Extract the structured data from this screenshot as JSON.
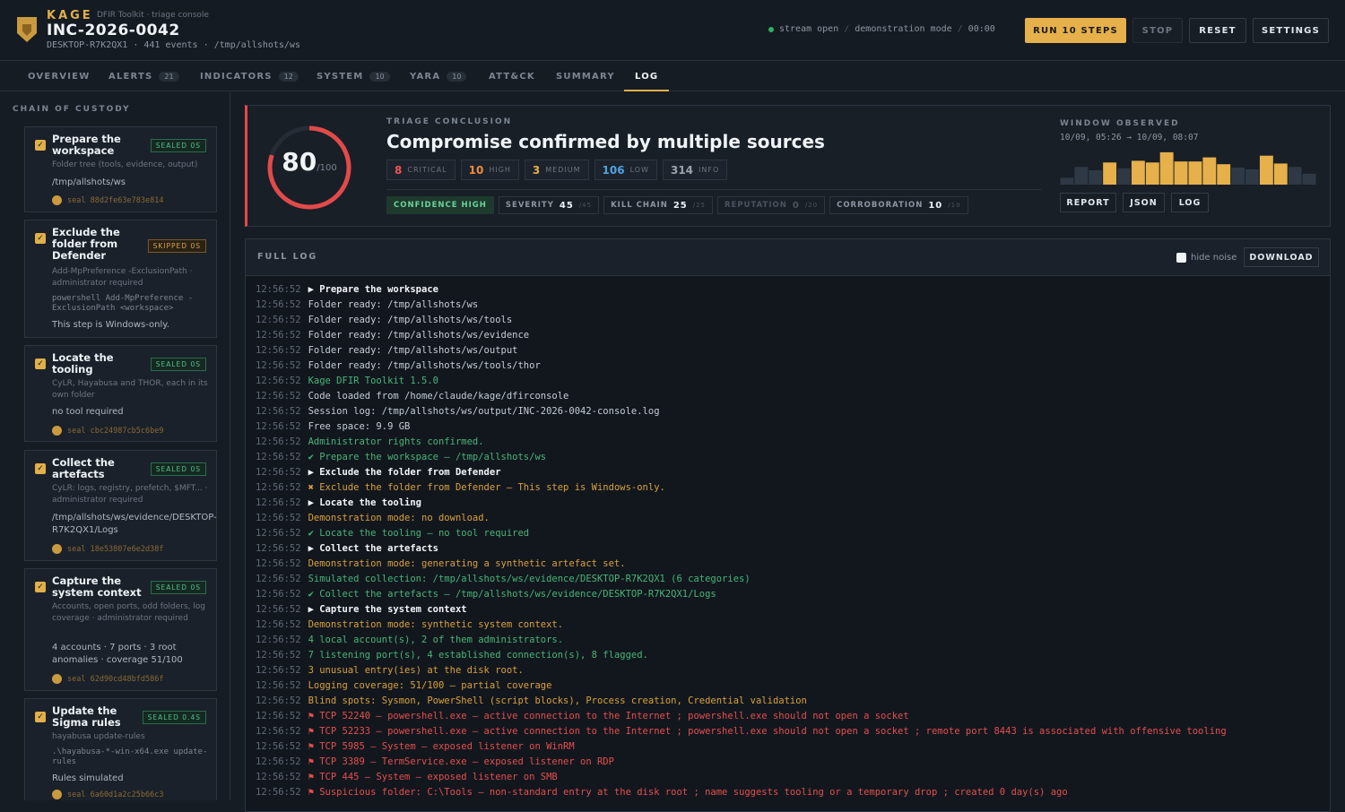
{
  "header": {
    "brand": "KAGE",
    "brand_sub": "DFIR Toolkit · triage console",
    "case_id": "INC-2026-0042",
    "meta": "DESKTOP-R7K2QX1 · 441 events · /tmp/allshots/ws",
    "status": {
      "stream": "stream open",
      "mode": "demonstration mode",
      "time": "00:00"
    },
    "buttons": {
      "run": "RUN 10 STEPS",
      "stop": "STOP",
      "reset": "RESET",
      "settings": "SETTINGS"
    }
  },
  "tabs": [
    {
      "label": "OVERVIEW",
      "count": ""
    },
    {
      "label": "ALERTS",
      "count": "21"
    },
    {
      "label": "INDICATORS",
      "count": "12"
    },
    {
      "label": "SYSTEM",
      "count": "10"
    },
    {
      "label": "YARA",
      "count": "10"
    },
    {
      "label": "ATT&CK",
      "count": ""
    },
    {
      "label": "SUMMARY",
      "count": ""
    },
    {
      "label": "LOG",
      "count": ""
    }
  ],
  "sidebar": {
    "title": "CHAIN OF CUSTODY",
    "steps": [
      {
        "title": "Prepare the workspace",
        "badge": "SEALED 0S",
        "desc": "Folder tree (tools, evidence, output)",
        "value": "/tmp/allshots/ws",
        "seal": "seal 88d2fe63e783e814"
      },
      {
        "title": "Exclude the folder from Defender",
        "badge": "SKIPPED 0S",
        "desc": "Add-MpPreference -ExclusionPath · administrator required",
        "cmd": "powershell Add-MpPreference -ExclusionPath <workspace>",
        "value": "This step is Windows-only."
      },
      {
        "title": "Locate the tooling",
        "badge": "SEALED 0S",
        "desc": "CyLR, Hayabusa and THOR, each in its own folder",
        "value": "no tool required",
        "seal": "seal cbc24987cb5c6be9"
      },
      {
        "title": "Collect the artefacts",
        "badge": "SEALED 0S",
        "desc": "CyLR: logs, registry, prefetch, $MFT... · administrator required",
        "value": "/tmp/allshots/ws/evidence/DESKTOP-R7K2QX1/Logs",
        "seal": "seal 18e53807e6e2d38f"
      },
      {
        "title": "Capture the system context",
        "badge": "SEALED 0S",
        "desc": "Accounts, open ports, odd folders, log coverage · administrator required",
        "value": "4 accounts · 7 ports · 3 root anomalies · coverage 51/100",
        "seal": "seal 62d90cd48bfd586f"
      },
      {
        "title": "Update the Sigma rules",
        "badge": "SEALED 0.4S",
        "desc": "hayabusa update-rules",
        "cmd": ".\\hayabusa-*-win-x64.exe update-rules",
        "value": "Rules simulated",
        "seal": "seal 6a60d1a2c25b66c3"
      }
    ]
  },
  "conclusion": {
    "label": "TRIAGE CONCLUSION",
    "title": "Compromise confirmed by multiple sources",
    "score": 80,
    "score_max": "/100",
    "severities": [
      {
        "n": "8",
        "l": "CRITICAL",
        "c": "#ef5350"
      },
      {
        "n": "10",
        "l": "HIGH",
        "c": "#f08a3c"
      },
      {
        "n": "3",
        "l": "MEDIUM",
        "c": "#e6b04a"
      },
      {
        "n": "106",
        "l": "LOW",
        "c": "#4ea3e0"
      },
      {
        "n": "314",
        "l": "INFO",
        "c": "#9aa3ad"
      }
    ],
    "pills": [
      {
        "l": "CONFIDENCE HIGH",
        "v": "",
        "m": "",
        "k": "conf"
      },
      {
        "l": "SEVERITY",
        "v": "45",
        "m": "/45",
        "k": ""
      },
      {
        "l": "KILL CHAIN",
        "v": "25",
        "m": "/25",
        "k": ""
      },
      {
        "l": "REPUTATION",
        "v": "0",
        "m": "/20",
        "k": "dim"
      },
      {
        "l": "CORROBORATION",
        "v": "10",
        "m": "/10",
        "k": ""
      }
    ],
    "window": {
      "label": "WINDOW OBSERVED",
      "range": "10/09, 05:26 → 10/09, 08:07",
      "hist": [
        0.2,
        0.52,
        0.42,
        0.65,
        0.48,
        0.7,
        0.65,
        0.95,
        0.68,
        0.68,
        0.8,
        0.6,
        0.5,
        0.45,
        0.85,
        0.62,
        0.52,
        0.32
      ]
    },
    "buttons": {
      "report": "REPORT",
      "json": "JSON",
      "log": "LOG"
    }
  },
  "log": {
    "title": "FULL LOG",
    "hide_noise": "hide noise",
    "download": "DOWNLOAD",
    "lines": [
      [
        "12:56:52",
        "▶ Prepare the workspace",
        "head"
      ],
      [
        "12:56:52",
        "Folder ready: /tmp/allshots/ws",
        "plain"
      ],
      [
        "12:56:52",
        "Folder ready: /tmp/allshots/ws/tools",
        "plain"
      ],
      [
        "12:56:52",
        "Folder ready: /tmp/allshots/ws/evidence",
        "plain"
      ],
      [
        "12:56:52",
        "Folder ready: /tmp/allshots/ws/output",
        "plain"
      ],
      [
        "12:56:52",
        "Folder ready: /tmp/allshots/ws/tools/thor",
        "plain"
      ],
      [
        "12:56:52",
        "Kage DFIR Toolkit 1.5.0",
        "green"
      ],
      [
        "12:56:52",
        "Code loaded from /home/claude/kage/dfirconsole",
        "plain"
      ],
      [
        "12:56:52",
        "Session log: /tmp/allshots/ws/output/INC-2026-0042-console.log",
        "plain"
      ],
      [
        "12:56:52",
        "Free space: 9.9 GB",
        "plain"
      ],
      [
        "12:56:52",
        "Administrator rights confirmed.",
        "green"
      ],
      [
        "12:56:52",
        "✔ Prepare the workspace — /tmp/allshots/ws",
        "green"
      ],
      [
        "12:56:52",
        "▶ Exclude the folder from Defender",
        "head"
      ],
      [
        "12:56:52",
        "✖ Exclude the folder from Defender — This step is Windows-only.",
        "amber"
      ],
      [
        "12:56:52",
        "▶ Locate the tooling",
        "head"
      ],
      [
        "12:56:52",
        "Demonstration mode: no download.",
        "amber"
      ],
      [
        "12:56:52",
        "✔ Locate the tooling — no tool required",
        "green"
      ],
      [
        "12:56:52",
        "▶ Collect the artefacts",
        "head"
      ],
      [
        "12:56:52",
        "Demonstration mode: generating a synthetic artefact set.",
        "amber"
      ],
      [
        "12:56:52",
        "Simulated collection: /tmp/allshots/ws/evidence/DESKTOP-R7K2QX1 (6 categories)",
        "green"
      ],
      [
        "12:56:52",
        "✔ Collect the artefacts — /tmp/allshots/ws/evidence/DESKTOP-R7K2QX1/Logs",
        "green"
      ],
      [
        "12:56:52",
        "▶ Capture the system context",
        "head"
      ],
      [
        "12:56:52",
        "Demonstration mode: synthetic system context.",
        "amber"
      ],
      [
        "12:56:52",
        "4 local account(s), 2 of them administrators.",
        "green"
      ],
      [
        "12:56:52",
        "7 listening port(s), 4 established connection(s), 8 flagged.",
        "green"
      ],
      [
        "12:56:52",
        "3 unusual entry(ies) at the disk root.",
        "amber"
      ],
      [
        "12:56:52",
        "Logging coverage: 51/100 — partial coverage",
        "amber"
      ],
      [
        "12:56:52",
        "Blind spots: Sysmon, PowerShell (script blocks), Process creation, Credential validation",
        "amber"
      ],
      [
        "12:56:52",
        "⚑ TCP 52240 — powershell.exe — active connection to the Internet ; powershell.exe should not open a socket",
        "red"
      ],
      [
        "12:56:52",
        "⚑ TCP 52233 — powershell.exe — active connection to the Internet ; powershell.exe should not open a socket ; remote port 8443 is associated with offensive tooling",
        "red"
      ],
      [
        "12:56:52",
        "⚑ TCP 5985 — System — exposed listener on WinRM",
        "red"
      ],
      [
        "12:56:52",
        "⚑ TCP 3389 — TermService.exe — exposed listener on RDP",
        "red"
      ],
      [
        "12:56:52",
        "⚑ TCP 445 — System — exposed listener on SMB",
        "red"
      ],
      [
        "12:56:52",
        "⚑ Suspicious folder: C:\\Tools — non-standard entry at the disk root ; name suggests tooling or a temporary drop ; created 0 day(s) ago",
        "red"
      ]
    ]
  }
}
